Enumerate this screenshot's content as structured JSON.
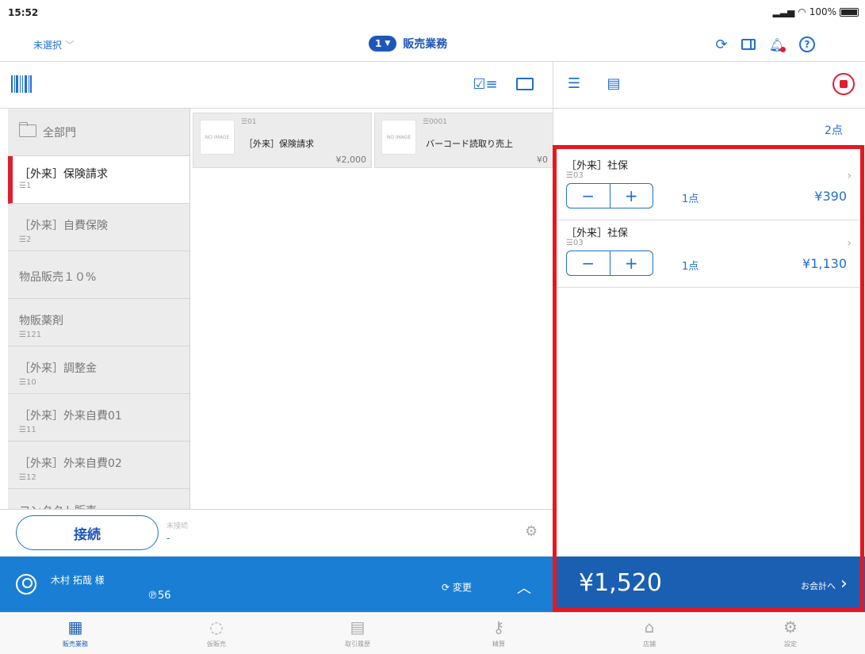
{
  "status": {
    "time": "15:52",
    "battery": "100%"
  },
  "nav": {
    "unselected": "未選択",
    "badge": "1",
    "title": "販売業務"
  },
  "categories": [
    {
      "name": "全部門",
      "code": ""
    },
    {
      "name": "［外来］保険請求",
      "code": "☰1"
    },
    {
      "name": "［外来］自費保険",
      "code": "☰2"
    },
    {
      "name": "物品販売１０%",
      "code": ""
    },
    {
      "name": "物販薬剤",
      "code": "☰121"
    },
    {
      "name": "［外来］調整金",
      "code": "☰10"
    },
    {
      "name": "［外来］外来自費01",
      "code": "☰11"
    },
    {
      "name": "［外来］外来自費02",
      "code": "☰12"
    },
    {
      "name": "コンタクト販売",
      "code": ""
    }
  ],
  "products": [
    {
      "image": "NO IMAGE",
      "code": "☰01",
      "name": "［外来］保険請求",
      "price": "¥2,000"
    },
    {
      "image": "NO IMAGE",
      "code": "☰0001",
      "name": "バーコード読取り売上",
      "price": "¥0"
    }
  ],
  "connection": {
    "button": "接続",
    "status": "未接続",
    "value": "-"
  },
  "customer": {
    "name": "木村 拓哉 様",
    "points": "℗56",
    "change": "変更"
  },
  "cart": {
    "count": "2点",
    "items": [
      {
        "name": "［外来］社保",
        "code": "☰03",
        "qty": "1点",
        "price": "¥390"
      },
      {
        "name": "［外来］社保",
        "code": "☰03",
        "qty": "1点",
        "price": "¥1,130"
      }
    ],
    "total": "¥1,520",
    "checkout": "お会計へ"
  },
  "tabs": [
    {
      "label": "販売業務",
      "icon": "register-icon"
    },
    {
      "label": "仮販売",
      "icon": "temp-register-icon"
    },
    {
      "label": "取引履歴",
      "icon": "history-book-icon"
    },
    {
      "label": "精算",
      "icon": "key-icon"
    },
    {
      "label": "店舗",
      "icon": "store-home-icon"
    },
    {
      "label": "設定",
      "icon": "settings-gear-icon"
    }
  ],
  "colors": {
    "accent": "#1a7fd4",
    "accent_dark": "#1a5fb2",
    "alert": "#e01e2f"
  }
}
